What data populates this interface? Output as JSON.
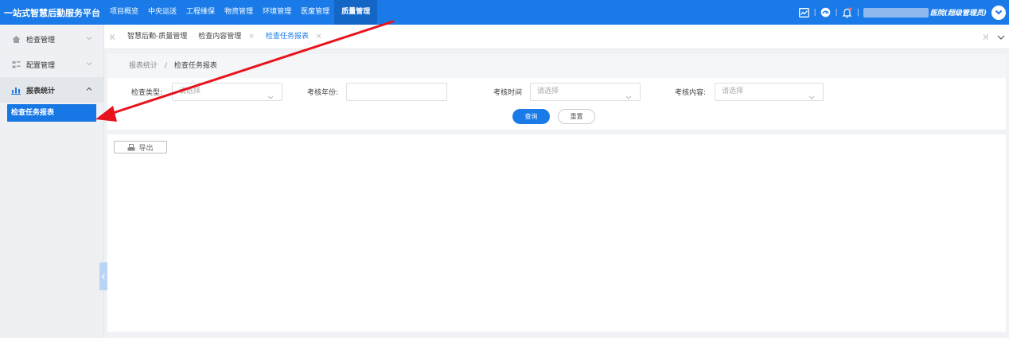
{
  "app": {
    "title": "一站式智慧后勤服务平台"
  },
  "nav": {
    "items": [
      {
        "label": "项目概览"
      },
      {
        "label": "中央运送"
      },
      {
        "label": "工程维保"
      },
      {
        "label": "物资管理"
      },
      {
        "label": "环境管理"
      },
      {
        "label": "医废管理"
      },
      {
        "label": "质量管理",
        "active": true
      }
    ]
  },
  "header": {
    "icons": [
      "chart-icon",
      "dashboard-icon",
      "bell-icon"
    ],
    "user": {
      "name": "医院(超级管理员)"
    }
  },
  "sidebar": {
    "items": [
      {
        "label": "检查管理",
        "icon": "home-icon"
      },
      {
        "label": "配置管理",
        "icon": "grid-icon"
      },
      {
        "label": "报表统计",
        "icon": "bar-chart-icon",
        "expanded": true
      }
    ],
    "active_sub": "检查任务报表"
  },
  "tabs": {
    "items": [
      {
        "label": "智慧后勤-质量管理"
      },
      {
        "label": "检查内容管理",
        "close": "×"
      },
      {
        "label": "检查任务报表",
        "close": "×",
        "active": true
      }
    ]
  },
  "breadcrumb": {
    "parent": "报表统计",
    "separator": "/",
    "current": "检查任务报表"
  },
  "filters": {
    "inspection_type": {
      "label": "检查类型:",
      "placeholder": "请选择"
    },
    "assessment_year": {
      "label": "考核年份:",
      "value": ""
    },
    "assessment_time": {
      "label": "考核时间",
      "placeholder": "请选择"
    },
    "assessment_content": {
      "label": "考核内容:",
      "placeholder": "请选择"
    },
    "query_label": "查询",
    "reset_label": "重置"
  },
  "toolbar": {
    "export_label": "导出"
  },
  "colors": {
    "primary": "#1a7be8",
    "annotation_arrow": "#e8121c"
  }
}
